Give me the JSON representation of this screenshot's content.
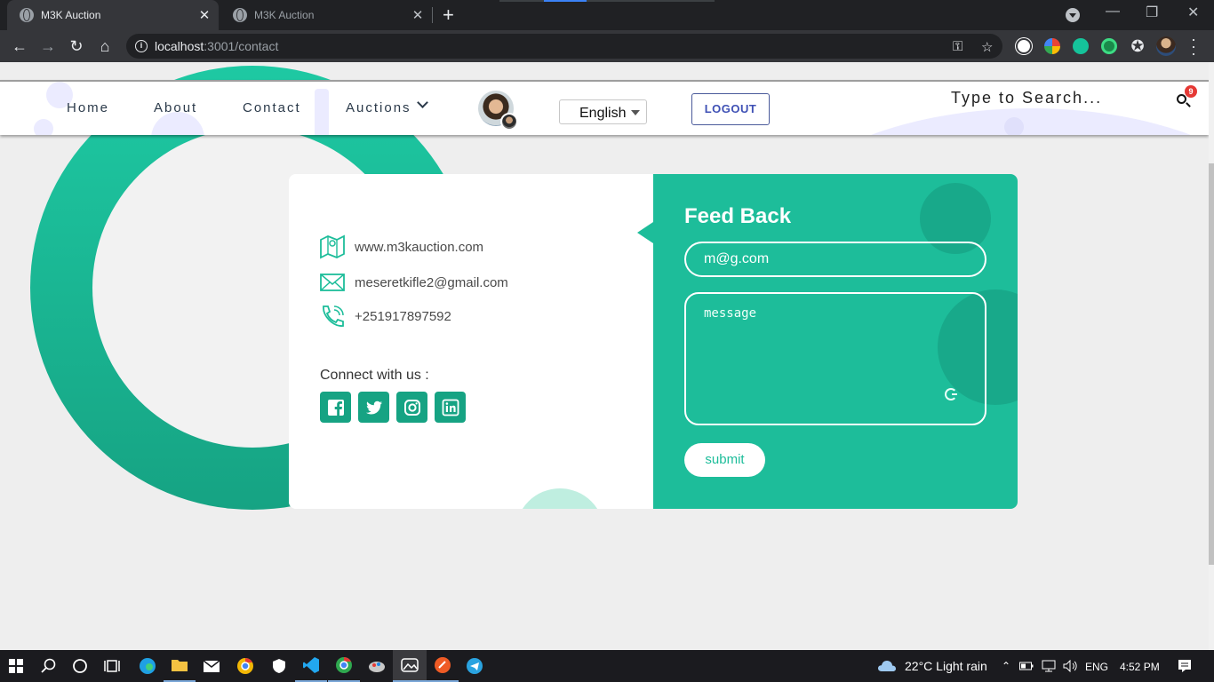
{
  "browser": {
    "tabs": [
      {
        "title": "M3K Auction",
        "active": true
      },
      {
        "title": "M3K Auction",
        "active": false
      }
    ],
    "new_tab": "+",
    "tab_close": "✕",
    "url_host": "localhost",
    "url_path": ":3001/contact",
    "window_controls": {
      "minimize": "—",
      "restore": "❐",
      "close": "✕"
    }
  },
  "navbar": {
    "links": [
      "Home",
      "About",
      "Contact",
      "Auctions"
    ],
    "language": "English",
    "logout_label": "LOGOUT",
    "search_placeholder": "Type to Search...",
    "notification_count": "9"
  },
  "contact": {
    "website": "www.m3kauction.com",
    "email": "meseretkifle2@gmail.com",
    "phone": "+251917897592",
    "connect_label": "Connect with us :",
    "socials": [
      "facebook-icon",
      "twitter-icon",
      "instagram-icon",
      "linkedin-icon"
    ]
  },
  "feedback": {
    "title": "Feed Back",
    "email_value": "m@g.com",
    "message_placeholder": "message",
    "submit_label": "submit"
  },
  "taskbar": {
    "weather": "22°C  Light rain",
    "language": "ENG",
    "time": "4:52 PM"
  },
  "colors": {
    "accent": "#1dbd9a",
    "accent_dark": "#16a383",
    "logout_text": "#3f51b5",
    "badge": "#e53935"
  }
}
